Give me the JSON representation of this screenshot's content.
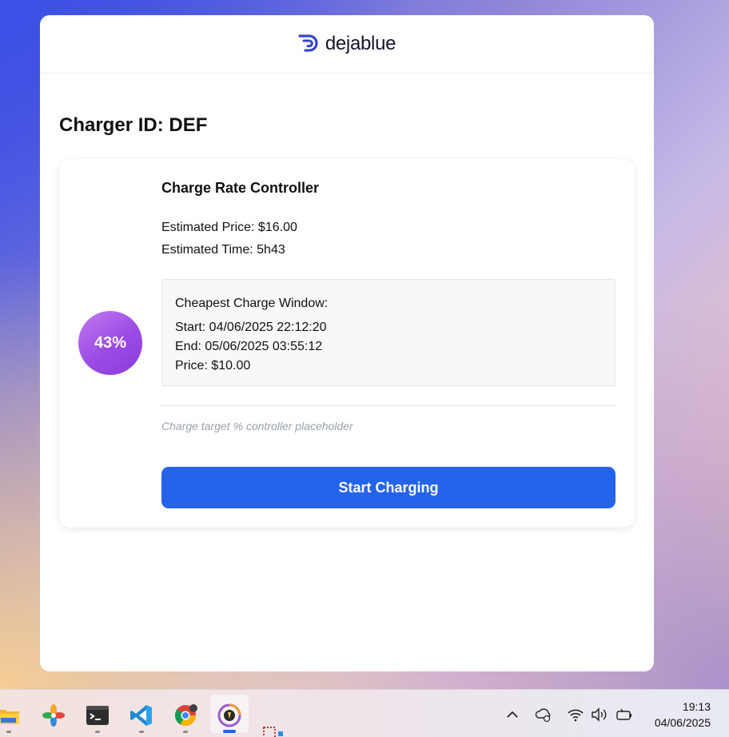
{
  "app": {
    "brand": "dejablue",
    "colors": {
      "accent": "#2563eb",
      "badge": "#9b4be5",
      "brand_mark": "#3647c8"
    }
  },
  "page": {
    "title": "Charger ID: DEF"
  },
  "card": {
    "soc_percent_label": "43%",
    "title": "Charge Rate Controller",
    "estimated_price": "Estimated Price: $16.00",
    "estimated_time": "Estimated Time: 5h43",
    "cheapest_window": {
      "heading": "Cheapest Charge Window:",
      "start": "Start: 04/06/2025 22:12:20",
      "end": "End: 05/06/2025 03:55:12",
      "price": "Price: $10.00"
    },
    "target_placeholder": "Charge target % controller placeholder",
    "start_button": "Start Charging"
  },
  "taskbar": {
    "apps": [
      "file-explorer-icon",
      "photos-icon",
      "terminal-icon",
      "vscode-icon",
      "chrome-icon",
      "app-icon"
    ],
    "tray": [
      "chevron-up-icon",
      "cloud-sync-icon",
      "wifi-icon",
      "volume-icon",
      "battery-icon"
    ],
    "time": "19:13",
    "date": "04/06/2025"
  }
}
